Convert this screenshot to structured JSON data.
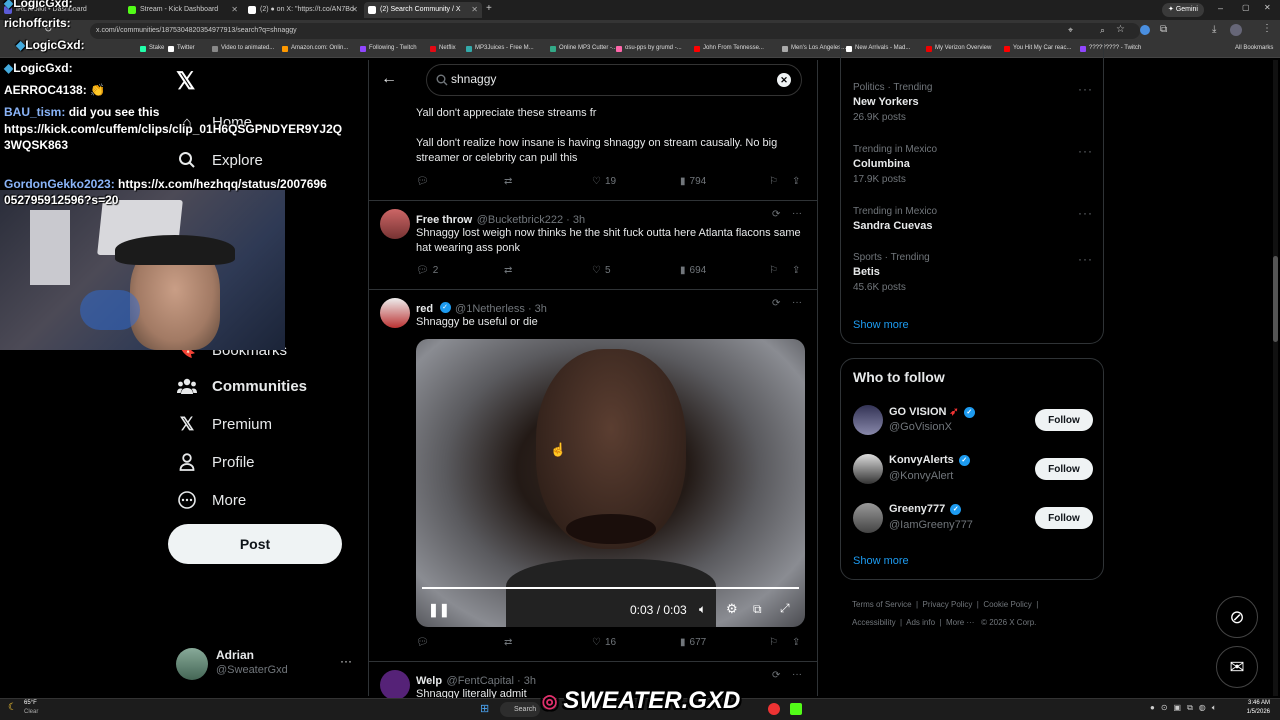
{
  "browser": {
    "tabs": [
      {
        "label": "IRLToolkit • Dashboard",
        "color": "#5b5bd6"
      },
      {
        "label": "Stream - Kick Dashboard",
        "color": "#53fc18"
      },
      {
        "label": "(2) ● on X: \"https://t.co/AN7Bd",
        "color": "#ffffff"
      },
      {
        "label": "(2) Search Community / X",
        "color": "#ffffff"
      }
    ],
    "new_tab": "+",
    "gemini_label": "Gemini",
    "url": "x.com/i/communities/1875304820354977913/search?q=shnaggy",
    "bookmarks": [
      {
        "label": "Stake",
        "color": "#2fa"
      },
      {
        "label": "Twitter",
        "color": "#fff"
      },
      {
        "label": "Video to animated...",
        "color": "#888"
      },
      {
        "label": "Amazon.com: Onlin...",
        "color": "#f90"
      },
      {
        "label": "Following - Twitch",
        "color": "#9146ff"
      },
      {
        "label": "Netflix",
        "color": "#e50914"
      },
      {
        "label": "MP3Juices - Free M...",
        "color": "#3aa"
      },
      {
        "label": "Online MP3 Cutter -...",
        "color": "#3a8"
      },
      {
        "label": "osu-pps by grumd -...",
        "color": "#f6a"
      },
      {
        "label": "John From Tennesse...",
        "color": "#f00"
      },
      {
        "label": "Men's Los Angeles...",
        "color": "#aaa"
      },
      {
        "label": "New Arrivals - Mad...",
        "color": "#fff"
      },
      {
        "label": "My Verizon Overview",
        "color": "#e00"
      },
      {
        "label": "You Hit My Car reac...",
        "color": "#f00"
      },
      {
        "label": "????????? - Twitch",
        "color": "#9146ff"
      }
    ],
    "all_bookmarks": "All Bookmarks"
  },
  "chat": [
    {
      "user": "LogicGxd:",
      "text": "",
      "color": "#4ad"
    },
    {
      "user": "richoffcrits:",
      "text": "",
      "color": "#fff"
    },
    {
      "user": "LogicGxd:",
      "text": "",
      "color": "#4ad"
    },
    {
      "user": "LogicGxd:",
      "text": "",
      "color": "#4ad"
    },
    {
      "user": "AERROC4138:",
      "text": "",
      "color": "#fff"
    },
    {
      "user": "BAU_tism:",
      "text": "did you see this",
      "color": "#8ab4f8"
    },
    {
      "user": "",
      "text": "https://kick.com/cuffem/clips/clip_01H6QSGPNDYER9YJ2Q",
      "color": "#fff"
    },
    {
      "user": "",
      "text": "3WQSK863",
      "color": "#fff"
    },
    {
      "user": "GordonGekko2023:",
      "text": "https://x.com/hezhqq/status/2007696",
      "color": "#8ab4f8"
    },
    {
      "user": "",
      "text": "052795912596?s=20",
      "color": "#fff"
    }
  ],
  "nav": {
    "home": "Home",
    "explore": "Explore",
    "bookmarks": "Bookmarks",
    "communities": "Communities",
    "premium": "Premium",
    "profile": "Profile",
    "more": "More",
    "post": "Post"
  },
  "account": {
    "name": "Adrian",
    "handle": "@SweaterGxd"
  },
  "search": {
    "value": "shnaggy"
  },
  "tweets": [
    {
      "name": "",
      "handle": "",
      "text1": "Yall don't appreciate these streams fr",
      "text2": "Yall don't realize how insane is having shnaggy on stream causally. No big streamer or celebrity can pull this",
      "replies": "",
      "retweets": "",
      "likes": "19",
      "views": "794"
    },
    {
      "name": "Free throw",
      "handle": "@Bucketbrick222 · 3h",
      "text1": "Shnaggy lost weigh now thinks he the shit fuck outta here Atlanta flacons same hat wearing ass ponk",
      "replies": "2",
      "retweets": "",
      "likes": "5",
      "views": "694"
    },
    {
      "name": "red",
      "handle": "@1Netherless · 3h",
      "text1": "Shnaggy be useful or die",
      "video_time": "0:03 / 0:03",
      "video_progress": 1.0,
      "replies": "",
      "retweets": "",
      "likes": "16",
      "views": "677"
    },
    {
      "name": "Welp",
      "handle": "@FentCapital · 3h",
      "text1": "Shnaggy literally admit"
    }
  ],
  "trends": [
    {
      "meta": "Politics · Trending",
      "name": "New Yorkers",
      "count": "26.9K posts"
    },
    {
      "meta": "Trending in Mexico",
      "name": "Columbina",
      "count": "17.9K posts"
    },
    {
      "meta": "Trending in Mexico",
      "name": "Sandra Cuevas",
      "count": ""
    },
    {
      "meta": "Sports · Trending",
      "name": "Betis",
      "count": "45.6K posts"
    }
  ],
  "show_more": "Show more",
  "who_to_follow": {
    "title": "Who to follow",
    "users": [
      {
        "name": "GO VISION",
        "handle": "@GoVisionX",
        "button": "Follow"
      },
      {
        "name": "KonvyAlerts",
        "handle": "@KonvyAlert",
        "button": "Follow"
      },
      {
        "name": "Greeny777",
        "handle": "@IamGreeny777",
        "button": "Follow"
      }
    ],
    "show_more": "Show more"
  },
  "footer": {
    "row1": [
      "Terms of Service",
      "Privacy Policy",
      "Cookie Policy"
    ],
    "row2": [
      "Accessibility",
      "Ads info",
      "More ···",
      "© 2026 X Corp."
    ]
  },
  "taskbar": {
    "weather_temp": "65°F",
    "weather_desc": "Clear",
    "search": "Search",
    "time": "3:46 AM",
    "date": "1/5/2026"
  },
  "overlay_brand": "SWEATER.GXD",
  "colors": {
    "accent": "#1d9bf0",
    "bg": "#000000",
    "border": "#2f3336"
  }
}
